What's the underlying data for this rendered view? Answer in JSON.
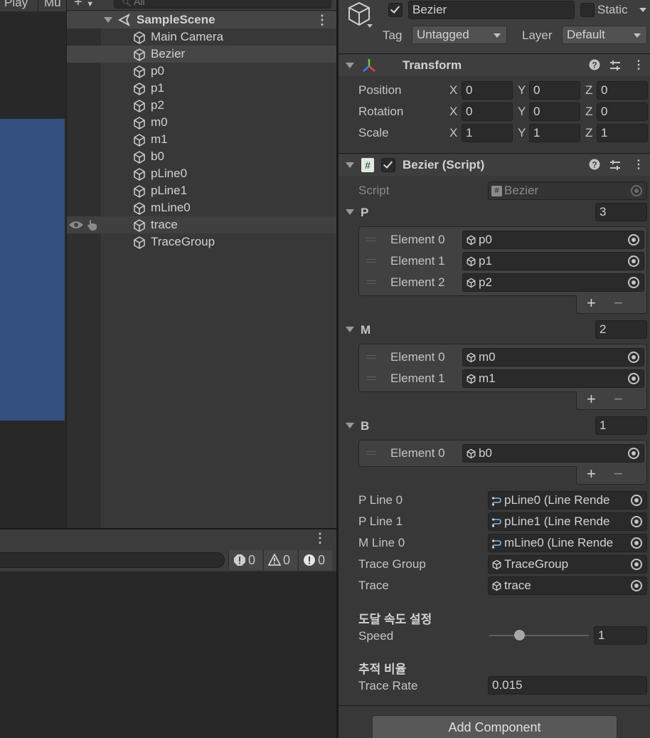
{
  "left_toolbar": {
    "play_label": "Play",
    "mute_label": "Mu"
  },
  "hierarchy": {
    "add_label": "+",
    "search_placeholder": "All",
    "scene_name": "SampleScene",
    "items": [
      {
        "label": "Main Camera"
      },
      {
        "label": "Bezier"
      },
      {
        "label": "p0"
      },
      {
        "label": "p1"
      },
      {
        "label": "p2"
      },
      {
        "label": "m0"
      },
      {
        "label": "m1"
      },
      {
        "label": "b0"
      },
      {
        "label": "pLine0"
      },
      {
        "label": "pLine1"
      },
      {
        "label": "mLine0"
      },
      {
        "label": "trace"
      },
      {
        "label": "TraceGroup"
      }
    ],
    "menu_glyph": "⋮"
  },
  "console": {
    "menu_glyph": "⋮",
    "error_count": "0",
    "warning_count": "0",
    "info_count": "0"
  },
  "inspector": {
    "object_name": "Bezier",
    "static_label": "Static",
    "tag_label": "Tag",
    "tag_value": "Untagged",
    "layer_label": "Layer",
    "layer_value": "Default",
    "transform": {
      "title": "Transform",
      "position_label": "Position",
      "rotation_label": "Rotation",
      "scale_label": "Scale",
      "x_label": "X",
      "y_label": "Y",
      "z_label": "Z",
      "position": [
        "0",
        "0",
        "0"
      ],
      "rotation": [
        "0",
        "0",
        "0"
      ],
      "scale": [
        "1",
        "1",
        "1"
      ]
    },
    "script_component": {
      "title": "Bezier (Script)",
      "script_label": "Script",
      "script_value": "Bezier",
      "p": {
        "label": "P",
        "size": "3",
        "elements": [
          {
            "label": "Element 0",
            "value": "p0"
          },
          {
            "label": "Element 1",
            "value": "p1"
          },
          {
            "label": "Element 2",
            "value": "p2"
          }
        ]
      },
      "m": {
        "label": "M",
        "size": "2",
        "elements": [
          {
            "label": "Element 0",
            "value": "m0"
          },
          {
            "label": "Element 1",
            "value": "m1"
          }
        ]
      },
      "b": {
        "label": "B",
        "size": "1",
        "elements": [
          {
            "label": "Element 0",
            "value": "b0"
          }
        ]
      },
      "plus": "+",
      "minus": "−",
      "p_line0_label": "P Line 0",
      "p_line0_value": "pLine0 (Line Rende",
      "p_line1_label": "P Line 1",
      "p_line1_value": "pLine1 (Line Rende",
      "m_line0_label": "M Line 0",
      "m_line0_value": "mLine0 (Line Rende",
      "trace_group_label": "Trace Group",
      "trace_group_value": "TraceGroup",
      "trace_label": "Trace",
      "trace_value": "trace",
      "speed_header": "도달 속도 설정",
      "speed_label": "Speed",
      "speed_value": "1",
      "speed_slider_fraction": 0.3,
      "rate_header": "추적 비율",
      "trace_rate_label": "Trace Rate",
      "trace_rate_value": "0.015"
    },
    "add_component_label": "Add Component"
  },
  "colors": {
    "game_view_bg": "#33507e",
    "panel_bg": "#383838",
    "field_bg": "#2a2a2a"
  }
}
